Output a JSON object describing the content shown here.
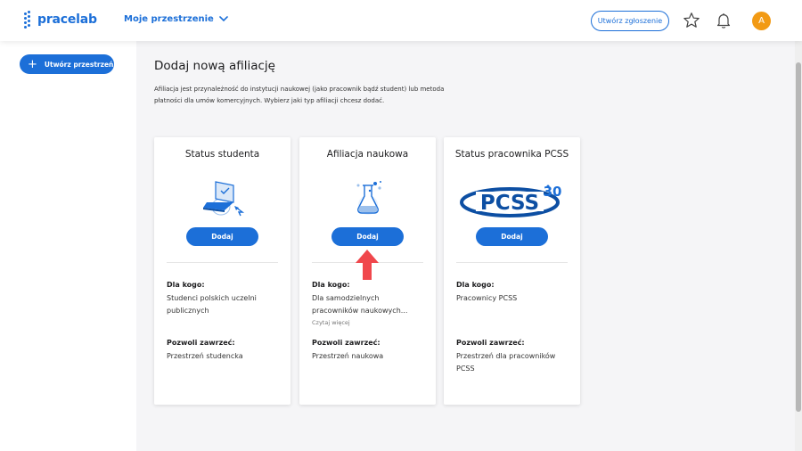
{
  "header": {
    "logo_text": "pracelab",
    "space_selector": "Moje przestrzenie",
    "report_button": "Utwórz zgłoszenie",
    "avatar_initial": "A",
    "brand_color": "#1c6fd8",
    "avatar_color": "#f29a14"
  },
  "sidebar": {
    "create_space": "Utwórz przestrzeń"
  },
  "main": {
    "title": "Dodaj nową afiliację",
    "intro": "Afiliacja jest przynależność do instytucji naukowej (jako pracownik bądź student) lub metoda płatności dla umów komercyjnych. Wybierz jaki typ afiliacji chcesz dodać.",
    "cards": [
      {
        "title": "Status studenta",
        "image": "student-laptop-illustration",
        "button": "Dodaj",
        "for_label": "Dla kogo:",
        "for_value": "Studenci polskich uczelni publicznych",
        "allows_label": "Pozwoli zawrzeć:",
        "allows_value": "Przestrzeń studencka"
      },
      {
        "title": "Afiliacja naukowa",
        "image": "science-flask-illustration",
        "button": "Dodaj",
        "for_label": "Dla kogo:",
        "for_value": "Dla samodzielnych pracowników naukowych...",
        "read_more": "Czytaj więcej",
        "allows_label": "Pozwoli zawrzeć:",
        "allows_value": "Przestrzeń naukowa"
      },
      {
        "title": "Status pracownika PCSS",
        "image": "pcss-30-logo",
        "logo_text": "PCSS",
        "logo_badge": "30",
        "button": "Dodaj",
        "for_label": "Dla kogo:",
        "for_value": "Pracownicy PCSS",
        "allows_label": "Pozwoli zawrzeć:",
        "allows_value": "Przestrzeń dla pracowników PCSS"
      }
    ]
  },
  "annotation": {
    "arrow_color": "#f0474c",
    "icon": "red-up-arrow"
  }
}
